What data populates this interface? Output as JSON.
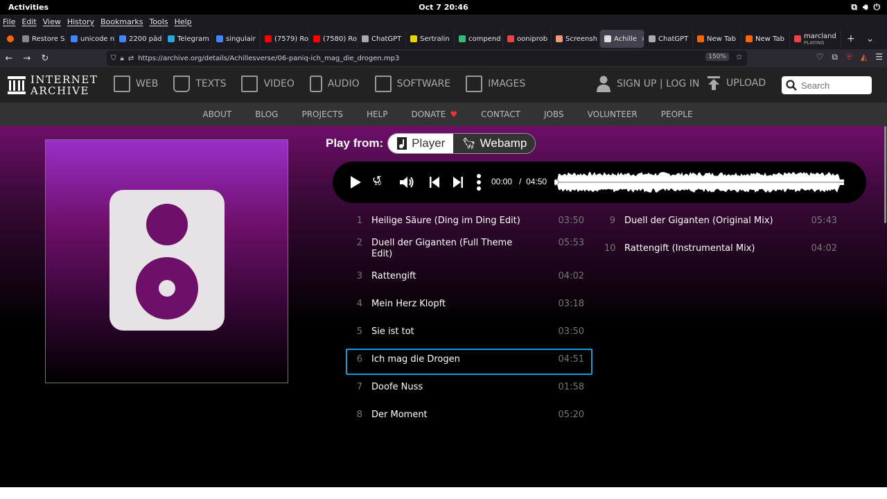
{
  "system": {
    "activities": "Activities",
    "clock": "Oct 7  20:46"
  },
  "menu": [
    "File",
    "Edit",
    "View",
    "History",
    "Bookmarks",
    "Tools",
    "Help"
  ],
  "tabs": [
    {
      "label": "Restore S",
      "color": "#888"
    },
    {
      "label": "unicode n",
      "color": "#4285f4"
    },
    {
      "label": "2200 päd",
      "color": "#4285f4"
    },
    {
      "label": "Telegram",
      "color": "#2ca5e0"
    },
    {
      "label": "singulair",
      "color": "#4285f4"
    },
    {
      "label": "(7579) Ro",
      "color": "#f00"
    },
    {
      "label": "(7580) Ro",
      "color": "#f00"
    },
    {
      "label": "ChatGPT",
      "color": "#aaa"
    },
    {
      "label": "Sertralin",
      "color": "#e8d400"
    },
    {
      "label": "compend",
      "color": "#3b7"
    },
    {
      "label": "ooniprob",
      "color": "#e44"
    },
    {
      "label": "Screensh",
      "color": "#e97"
    },
    {
      "label": "Achille",
      "color": "#ddd",
      "active": true
    },
    {
      "label": "ChatGPT",
      "color": "#aaa"
    },
    {
      "label": "New Tab",
      "color": "#f60"
    },
    {
      "label": "New Tab",
      "color": "#f60"
    },
    {
      "label": "marcland",
      "color": "#e44",
      "sub": "PLAYING"
    }
  ],
  "address": {
    "url": "https://archive.org/details/Achillesverse/06-paniq-ich_mag_die_drogen.mp3",
    "zoom": "150%"
  },
  "ia": {
    "logo_line1": "INTERNET",
    "logo_line2": "ARCHIVE",
    "nav": [
      "WEB",
      "TEXTS",
      "VIDEO",
      "AUDIO",
      "SOFTWARE",
      "IMAGES"
    ],
    "signup": "SIGN UP | LOG IN",
    "upload": "UPLOAD",
    "search_placeholder": "Search",
    "subnav": [
      "ABOUT",
      "BLOG",
      "PROJECTS",
      "HELP",
      "DONATE",
      "CONTACT",
      "JOBS",
      "VOLUNTEER",
      "PEOPLE"
    ],
    "heart": "♥"
  },
  "player": {
    "play_from": "Play from:",
    "opt_player": "Player",
    "opt_webamp": "Webamp",
    "current_time": "00:00",
    "separator": "/",
    "total_time": "04:50",
    "replay_label": "10"
  },
  "tracks": [
    {
      "num": "1",
      "title": "Heilige Säure (Ding im Ding Edit)",
      "dur": "03:50"
    },
    {
      "num": "2",
      "title": "Duell der Giganten (Full Theme Edit)",
      "dur": "05:53"
    },
    {
      "num": "3",
      "title": "Rattengift",
      "dur": "04:02"
    },
    {
      "num": "4",
      "title": "Mein Herz Klopft",
      "dur": "03:18"
    },
    {
      "num": "5",
      "title": "Sie ist tot",
      "dur": "03:50"
    },
    {
      "num": "6",
      "title": "Ich mag die Drogen",
      "dur": "04:51",
      "active": true
    },
    {
      "num": "7",
      "title": "Doofe Nuss",
      "dur": "01:58"
    },
    {
      "num": "8",
      "title": "Der Moment",
      "dur": "05:20"
    },
    {
      "num": "9",
      "title": "Duell der Giganten (Original Mix)",
      "dur": "05:43"
    },
    {
      "num": "10",
      "title": "Rattengift (Instrumental Mix)",
      "dur": "04:02"
    }
  ]
}
